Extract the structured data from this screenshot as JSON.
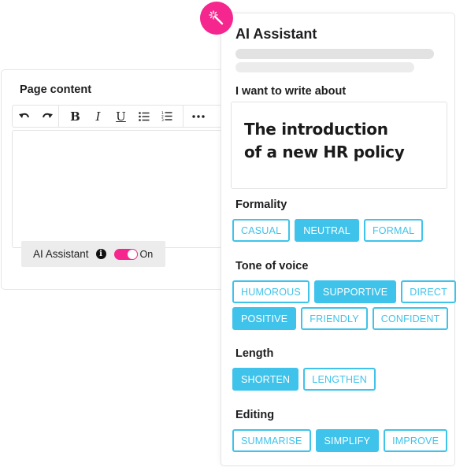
{
  "editor": {
    "title": "Page content",
    "toolbar": {
      "groups": [
        [
          {
            "icon": "undo-icon",
            "label": "Undo"
          },
          {
            "icon": "redo-icon",
            "label": "Redo"
          }
        ],
        [
          {
            "icon": "bold-icon",
            "label": "B"
          },
          {
            "icon": "italic-icon",
            "label": "I"
          },
          {
            "icon": "underline-icon",
            "label": "U"
          },
          {
            "icon": "bullet-list-icon",
            "label": "Bulleted list"
          },
          {
            "icon": "numbered-list-icon",
            "label": "Numbered list"
          }
        ],
        [
          {
            "icon": "more-icon",
            "label": "More"
          }
        ]
      ]
    },
    "content": "",
    "ai_toggle": {
      "label": "AI Assistant",
      "info_icon": "i",
      "state_label": "On",
      "enabled": true
    }
  },
  "ai_panel": {
    "title": "AI Assistant",
    "wand_icon": "magic-wand-icon",
    "topic_label": "I want to write about",
    "topic_line1": "The introduction",
    "topic_line2": "of a new HR policy",
    "sections": {
      "formality": {
        "label": "Formality",
        "options": [
          {
            "label": "CASUAL",
            "selected": false
          },
          {
            "label": "NEUTRAL",
            "selected": true
          },
          {
            "label": "FORMAL",
            "selected": false
          }
        ]
      },
      "tone": {
        "label": "Tone of voice",
        "options": [
          {
            "label": "HUMOROUS",
            "selected": false
          },
          {
            "label": "SUPPORTIVE",
            "selected": true
          },
          {
            "label": "DIRECT",
            "selected": false
          },
          {
            "label": "POSITIVE",
            "selected": true
          },
          {
            "label": "FRIENDLY",
            "selected": false
          },
          {
            "label": "CONFIDENT",
            "selected": false
          }
        ]
      },
      "length": {
        "label": "Length",
        "options": [
          {
            "label": "SHORTEN",
            "selected": true
          },
          {
            "label": "LENGTHEN",
            "selected": false
          }
        ]
      },
      "editing": {
        "label": "Editing",
        "options": [
          {
            "label": "SUMMARISE",
            "selected": false
          },
          {
            "label": "SIMPLIFY",
            "selected": true
          },
          {
            "label": "IMPROVE",
            "selected": false
          }
        ]
      }
    }
  },
  "colors": {
    "accent_pink": "#f5278e",
    "accent_cyan": "#3fc3ea"
  }
}
